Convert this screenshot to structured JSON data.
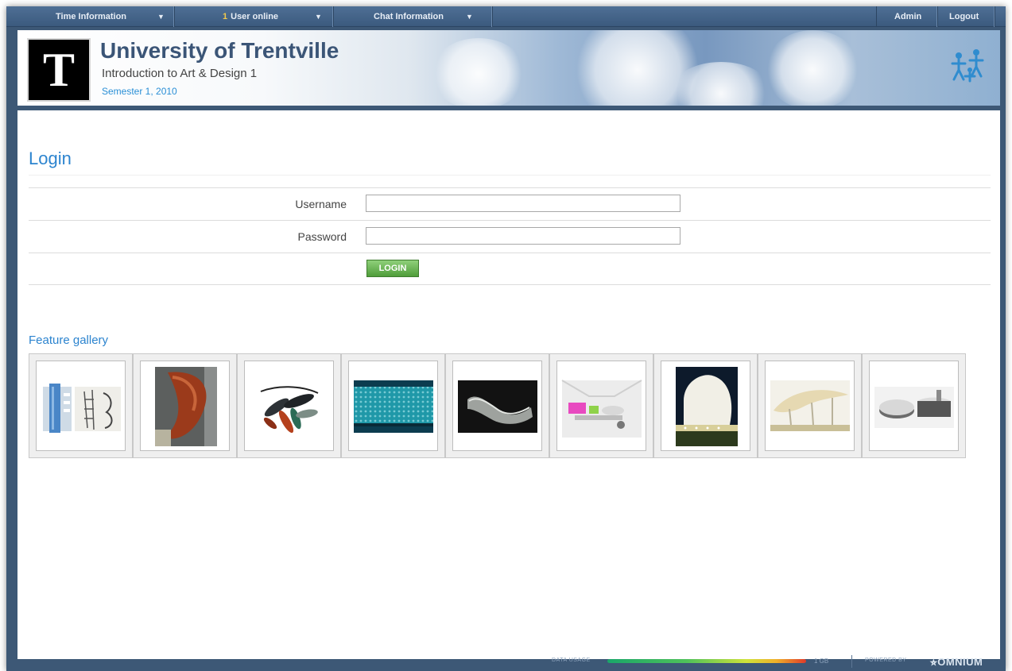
{
  "topbar": {
    "time_info": "Time Information",
    "users_count": "1",
    "users_label": "User online",
    "chat_info": "Chat Information",
    "admin": "Admin",
    "logout": "Logout"
  },
  "header": {
    "logo_letter": "T",
    "university": "University of Trentville",
    "course": "Introduction to Art & Design 1",
    "semester": "Semester 1, 2010"
  },
  "login": {
    "title": "Login",
    "username_label": "Username",
    "password_label": "Password",
    "username_value": "",
    "password_value": "",
    "button_label": "LOGIN"
  },
  "gallery": {
    "title": "Feature gallery",
    "items": [
      "tower-sketch",
      "red-sculpture",
      "necklace",
      "glass-building",
      "chaise-lounge",
      "interior-render",
      "dome-building",
      "canopy-structure",
      "curved-model"
    ]
  },
  "footer": {
    "usage_label": "DATA USAGE",
    "usage_fraction": 0.97,
    "usage_size": "1 GB",
    "powered_label": "POWERED BY",
    "brand": "OMNIUM"
  },
  "colors": {
    "frame": "#3d5876",
    "accent_blue": "#2c84cf",
    "login_green": "#4f9d3a"
  }
}
